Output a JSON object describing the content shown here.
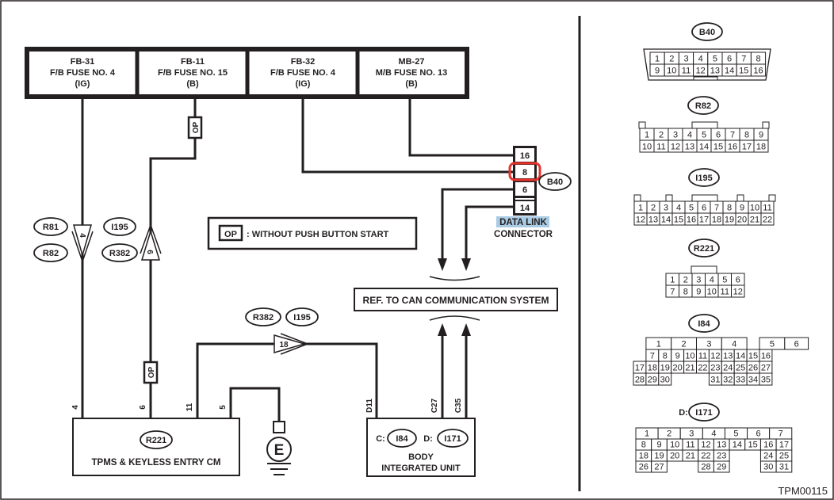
{
  "diagram_id": "TPM00115",
  "fuses": [
    {
      "line1": "FB-31",
      "line2": "F/B FUSE NO. 4",
      "line3": "(IG)"
    },
    {
      "line1": "FB-11",
      "line2": "F/B FUSE NO. 15",
      "line3": "(B)"
    },
    {
      "line1": "FB-32",
      "line2": "F/B FUSE NO. 4",
      "line3": "(IG)"
    },
    {
      "line1": "MB-27",
      "line2": "M/B FUSE NO. 13",
      "line3": "(B)"
    }
  ],
  "op_tag": "OP",
  "legend": {
    "tag": "OP",
    "text": ": WITHOUT PUSH BUTTON START"
  },
  "inline_connectors": {
    "left": {
      "pin": "4",
      "refs": [
        "R81",
        "R82"
      ]
    },
    "middle": {
      "pin": "6",
      "refs": [
        "I195",
        "R382"
      ]
    },
    "bottom": {
      "pin": "18",
      "refs": [
        "R382",
        "I195"
      ]
    }
  },
  "data_link": {
    "pins": [
      "16",
      "8",
      "6",
      "14"
    ],
    "highlighted_pin": "8",
    "ref": "B40",
    "label1": "DATA LINK",
    "label2": "CONNECTOR",
    "highlight_color": "#e8332c",
    "label_bg": "#a9cbe3"
  },
  "can_ref": "REF. TO CAN COMMUNICATION SYSTEM",
  "tpms": {
    "ref": "R221",
    "name": "TPMS & KEYLESS ENTRY CM",
    "pins": [
      "4",
      "6",
      "11",
      "5"
    ]
  },
  "ground_label": "E",
  "biu": {
    "c_label": "C:",
    "c_ref": "I84",
    "d_label": "D:",
    "d_ref": "I171",
    "line1": "BODY",
    "line2": "INTEGRATED UNIT",
    "pins": [
      "D11",
      "C27",
      "C35"
    ]
  },
  "connector_views": {
    "b40": {
      "ref": "B40",
      "row1": [
        "1",
        "2",
        "3",
        "4",
        "5",
        "6",
        "7",
        "8"
      ],
      "row2": [
        "9",
        "10",
        "11",
        "12",
        "13",
        "14",
        "15",
        "16"
      ]
    },
    "r82": {
      "ref": "R82",
      "row1": [
        "1",
        "2",
        "3",
        "4",
        "5",
        "6",
        "7",
        "8",
        "9"
      ],
      "row2": [
        "10",
        "11",
        "12",
        "13",
        "14",
        "15",
        "16",
        "17",
        "18"
      ]
    },
    "i195": {
      "ref": "I195",
      "row1": [
        "1",
        "2",
        "3",
        "4",
        "5",
        "6",
        "7",
        "8",
        "9",
        "10",
        "11"
      ],
      "row2": [
        "12",
        "13",
        "14",
        "15",
        "16",
        "17",
        "18",
        "19",
        "20",
        "21",
        "22"
      ]
    },
    "r221": {
      "ref": "R221",
      "row1": [
        "1",
        "2",
        "3",
        "4",
        "5",
        "6"
      ],
      "row2": [
        "7",
        "8",
        "9",
        "10",
        "11",
        "12"
      ]
    },
    "i84": {
      "ref": "I84",
      "row1": [
        "1",
        "2",
        "3",
        "4",
        "",
        "5",
        "6"
      ],
      "row2": [
        "7",
        "8",
        "9",
        "10",
        "11",
        "12",
        "13",
        "14",
        "15",
        "16"
      ],
      "row3": [
        "17",
        "18",
        "19",
        "20",
        "21",
        "22",
        "23",
        "24",
        "25",
        "26",
        "27"
      ],
      "row4": [
        "28",
        "29",
        "30",
        "31",
        "32",
        "33",
        "34",
        "35"
      ]
    },
    "i171": {
      "prefix": "D:",
      "ref": "I171",
      "row1": [
        "1",
        "2",
        "3",
        "4",
        "5",
        "6",
        "7"
      ],
      "row2": [
        "8",
        "9",
        "10",
        "11",
        "12",
        "13",
        "14",
        "15",
        "16",
        "17"
      ],
      "row3": [
        "18",
        "19",
        "20",
        "21",
        "22",
        "23",
        "24",
        "25"
      ],
      "row4": [
        "26",
        "27",
        "28",
        "29",
        "30",
        "31"
      ]
    }
  }
}
